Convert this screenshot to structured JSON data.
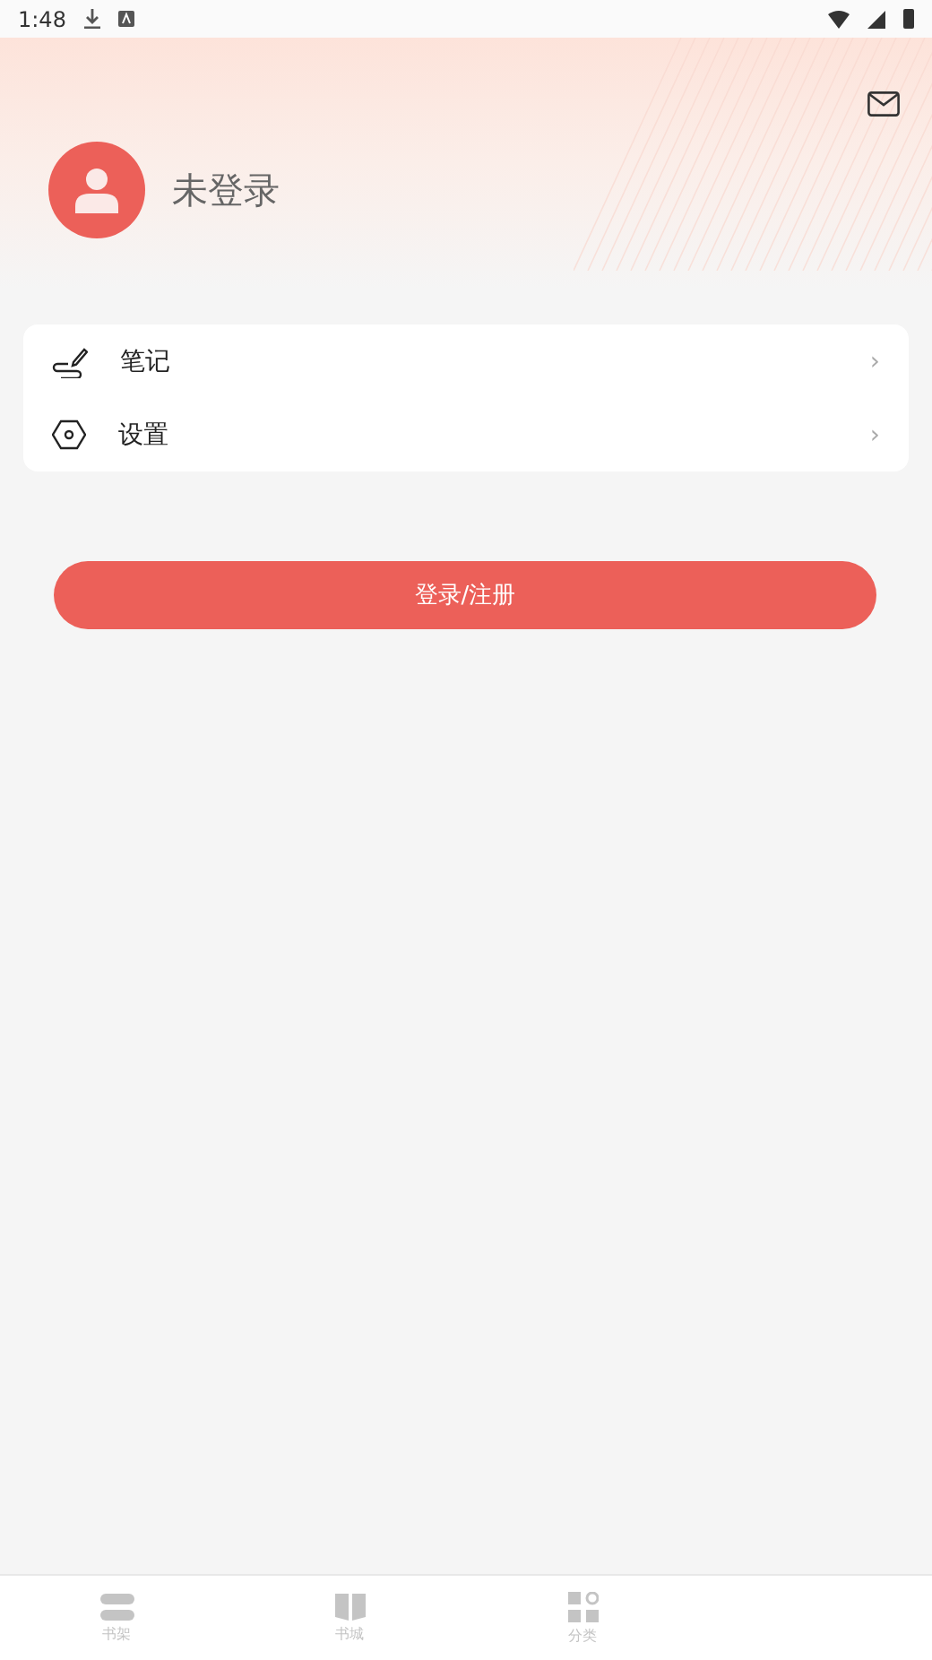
{
  "status_bar": {
    "time": "1:48"
  },
  "profile": {
    "name": "未登录"
  },
  "menu": [
    {
      "kind": "note",
      "label": "笔记",
      "chevron": "›"
    },
    {
      "kind": "settings",
      "label": "设置",
      "chevron": "›"
    }
  ],
  "login_button": "登录/注册",
  "bottom_nav": [
    {
      "kind": "shelf",
      "label": "书架",
      "selected": false
    },
    {
      "kind": "book",
      "label": "书城",
      "selected": false
    },
    {
      "kind": "grid",
      "label": "分类",
      "selected": false
    }
  ]
}
